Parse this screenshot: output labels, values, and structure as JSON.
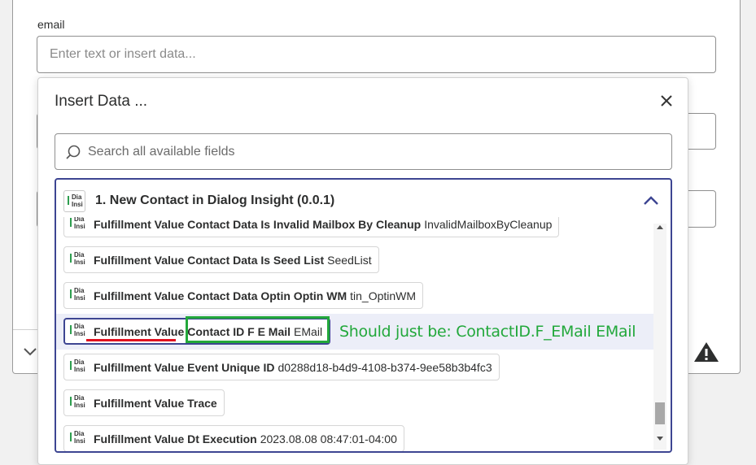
{
  "form": {
    "email_label": "email",
    "email_placeholder": "Enter text or insert data..."
  },
  "modal": {
    "title": "Insert Data ...",
    "search_placeholder": "Search all available fields"
  },
  "step": {
    "title": "1. New Contact in Dialog Insight (0.0.1)",
    "app_logo_text": [
      "Dia",
      "Insi"
    ]
  },
  "fields": [
    {
      "label": "Fulfillment Value Contact Data Is Invalid Mailbox By Cleanup",
      "value": "InvalidMailboxByCleanup"
    },
    {
      "label": "Fulfillment Value Contact Data Is Seed List",
      "value": "SeedList"
    },
    {
      "label": "Fulfillment Value Contact Data Optin Optin WM",
      "value": "tin_OptinWM"
    },
    {
      "label_first": "Fulfillment Value",
      "label_rest": "Contact ID F E Mail",
      "value": "EMail"
    },
    {
      "label": "Fulfillment Value Event Unique ID",
      "value": "d0288d18-b4d9-4108-b374-9ee58b3b4fc3"
    },
    {
      "label": "Fulfillment Value Trace",
      "value": ""
    },
    {
      "label": "Fulfillment Value Dt Execution",
      "value": "2023.08.08 08:47:01-04:00"
    }
  ],
  "annotation": {
    "text": "Should just be: ContactID.F_EMail EMail"
  },
  "colors": {
    "accent": "#3d4592",
    "annotation_green": "#22a83b",
    "underline_red": "#e0101f",
    "brand_green": "#2e9e4f"
  }
}
